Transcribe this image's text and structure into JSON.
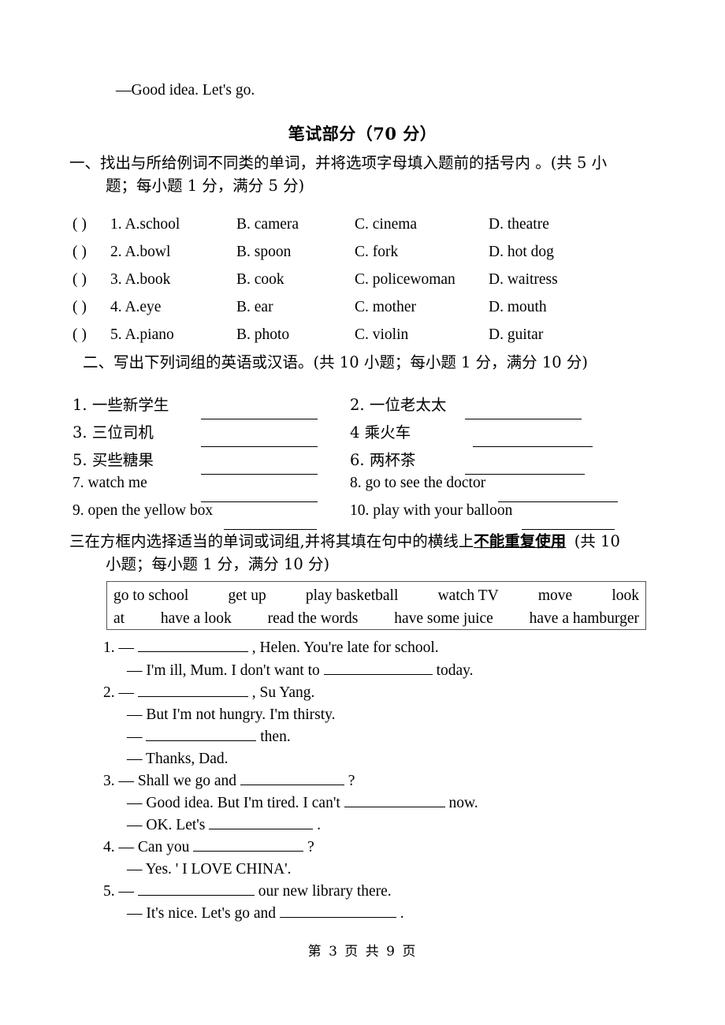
{
  "carryover_line": "—Good idea. Let's go.",
  "written_title": "笔试部分（70 分）",
  "section1": {
    "heading_line1": "一、找出与所给例词不同类的单词，并将选项字母填入题前的括号内 。(共 5 小",
    "heading_line2": "题；每小题 1 分，满分 5 分)",
    "paren": "(        )",
    "items": [
      {
        "num": "1.",
        "a": "A.school",
        "b": "B. camera",
        "c": "C. cinema",
        "d": "D. theatre"
      },
      {
        "num": "2.",
        "a": "A.bowl",
        "b": "B. spoon",
        "c": "C. fork",
        "d": "D. hot dog"
      },
      {
        "num": "3.",
        "a": "A.book",
        "b": "B. cook",
        "c": "C. policewoman",
        "d": "D. waitress"
      },
      {
        "num": "4.",
        "a": "A.eye",
        "b": "B. ear",
        "c": "C. mother",
        "d": "D. mouth"
      },
      {
        "num": "5.",
        "a": "A.piano",
        "b": "B. photo",
        "c": "C. violin",
        "d": "D. guitar"
      }
    ]
  },
  "section2": {
    "heading": "二、写出下列词组的英语或汉语。(共 10 小题；每小题 1 分，满分 10 分)",
    "rows": [
      {
        "left_num": "1.",
        "left_text": "一些新学生",
        "right_num": "2.",
        "right_text": "一位老太太"
      },
      {
        "left_num": "3.",
        "left_text": "三位司机",
        "right_num": "4",
        "right_text": "乘火车"
      },
      {
        "left_num": "5.",
        "left_text": "买些糖果",
        "right_num": "6.",
        "right_text": "两杯茶"
      },
      {
        "left_num": "7.",
        "left_text": "watch me",
        "right_num": "8.",
        "right_text": "go to see the doctor"
      },
      {
        "left_num": "9.",
        "left_text": "open the yellow box",
        "right_num": "10.",
        "right_text": "play with your balloon"
      }
    ]
  },
  "section3": {
    "heading_prefix": "三在方框内选择适当的单词或词组,并将其填在句中的横线上",
    "heading_underlined": "不能重复使用",
    "heading_dot": "。",
    "heading_suffix": "(共 10",
    "heading_line2": "小题；每小题 1 分，满分 10 分)",
    "wordbank_row1": [
      "go to school",
      "get up",
      "play basketball",
      "watch TV",
      "move",
      "look"
    ],
    "wordbank_row2": [
      "at",
      "have a look",
      "read the words",
      "have some juice",
      "have a hamburger"
    ],
    "dialogues": [
      {
        "num": "1.",
        "dash": "—",
        "pre": "",
        "post": ", Helen. You're late for school."
      },
      {
        "num": "",
        "dash": "—",
        "pre": "I'm ill, Mum. I don't want to",
        "post": "today."
      },
      {
        "num": "2.",
        "dash": "—",
        "pre": "",
        "post": ", Su Yang."
      },
      {
        "num": "",
        "dash": "—",
        "pre": "But I'm not hungry. I'm thirsty.",
        "post": ""
      },
      {
        "num": "",
        "dash": "—",
        "pre": "",
        "post": "then."
      },
      {
        "num": "",
        "dash": "—",
        "pre": "Thanks, Dad.",
        "post": ""
      },
      {
        "num": "3.",
        "dash": "—",
        "pre": "Shall we go and",
        "post": "?"
      },
      {
        "num": "",
        "dash": "—",
        "pre": "Good idea. But I'm tired. I can't",
        "post": "now."
      },
      {
        "num": "",
        "dash": "—",
        "pre": "OK. Let's",
        "post": "."
      },
      {
        "num": "4.",
        "dash": "—",
        "pre": "Can you",
        "post": "?"
      },
      {
        "num": "",
        "dash": "—",
        "pre": "Yes. ' I LOVE CHINA'.",
        "post": ""
      },
      {
        "num": "5.",
        "dash": "—",
        "pre": "",
        "post": "our new library there."
      },
      {
        "num": "",
        "dash": "—",
        "pre": "It's nice. Let's go and",
        "post": "."
      }
    ]
  },
  "footer": "第 3 页 共 9 页"
}
